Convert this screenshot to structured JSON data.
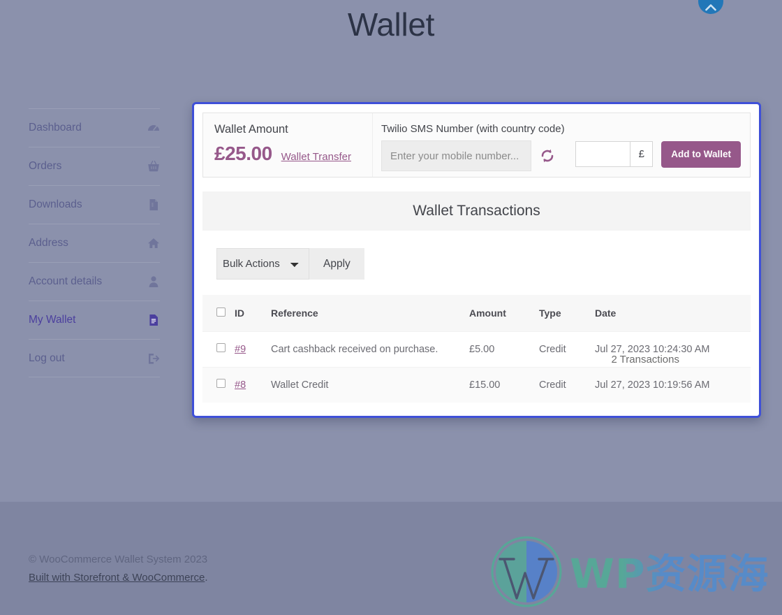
{
  "page": {
    "title": "Wallet"
  },
  "scroll_top": {
    "name": "scroll-to-top",
    "icon": "chevron-up-icon",
    "color": "#2277b8"
  },
  "sidebar": {
    "items": [
      {
        "label": "Dashboard",
        "icon": "dashboard-icon",
        "active": false
      },
      {
        "label": "Orders",
        "icon": "basket-icon",
        "active": false
      },
      {
        "label": "Downloads",
        "icon": "download-file-icon",
        "active": false
      },
      {
        "label": "Address",
        "icon": "home-icon",
        "active": false
      },
      {
        "label": "Account details",
        "icon": "user-icon",
        "active": false
      },
      {
        "label": "My Wallet",
        "icon": "document-icon",
        "active": true
      },
      {
        "label": "Log out",
        "icon": "logout-icon",
        "active": false
      }
    ]
  },
  "wallet": {
    "amount_label": "Wallet Amount",
    "amount_value": "£25.00",
    "transfer_link": "Wallet Transfer",
    "sms_label": "Twilio SMS Number (with country code)",
    "sms_placeholder": "Enter your mobile number...",
    "sms_value": "",
    "refresh_icon": "refresh-icon",
    "add_amount_value": "",
    "currency_symbol": "£",
    "add_button": "Add to Wallet",
    "accent_color": "#96588a",
    "panel_border_color": "#3f50d8"
  },
  "transactions": {
    "heading": "Wallet Transactions",
    "bulk_actions_selected": "Bulk Actions",
    "bulk_actions_options": [
      "Bulk Actions"
    ],
    "apply_button": "Apply",
    "count_text": "2 Transactions",
    "columns": [
      "",
      "ID",
      "Reference",
      "Amount",
      "Type",
      "Date"
    ],
    "rows": [
      {
        "id": "#9",
        "reference": "Cart cashback received on purchase.",
        "amount": "£5.00",
        "type": "Credit",
        "date": "Jul 27, 2023 10:24:30 AM"
      },
      {
        "id": "#8",
        "reference": "Wallet Credit",
        "amount": "£15.00",
        "type": "Credit",
        "date": "Jul 27, 2023 10:19:56 AM"
      }
    ]
  },
  "footer": {
    "copyright": "© WooCommerce Wallet System 2023",
    "built_with": "Built with Storefront & WooCommerce",
    "built_with_suffix": ".",
    "watermark_text": "WP资源海",
    "watermark_icon": "wordpress-logo-icon"
  }
}
